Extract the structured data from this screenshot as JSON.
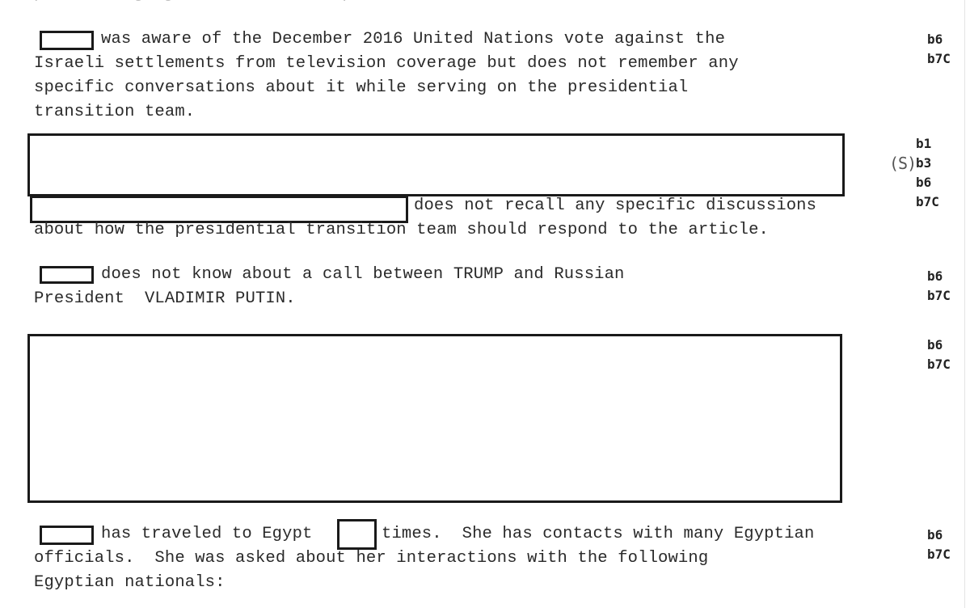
{
  "document": {
    "clipped_top_line": "preexisting agreements with respect to the other members",
    "paragraphs": [
      {
        "id": "un-vote",
        "lines": [
          "was aware of the December 2016 United Nations vote against the",
          "Israeli settlements from television coverage but does not remember any",
          "specific conversations about it while serving on the presidential",
          "transition team."
        ],
        "exemption_codes": [
          "b6",
          "b7C"
        ]
      },
      {
        "id": "article-response",
        "lines": [
          "does not recall any specific discussions",
          "about how the presidential transition team should respond to the article."
        ],
        "classification_mark": "(S)",
        "exemption_codes": [
          "b1",
          "b3",
          "b6",
          "b7C"
        ]
      },
      {
        "id": "putin-call",
        "lines": [
          "does not know about a call between TRUMP and Russian",
          "President  VLADIMIR PUTIN."
        ],
        "exemption_codes": [
          "b6",
          "b7C"
        ]
      },
      {
        "id": "fully-redacted",
        "lines": [],
        "exemption_codes": [
          "b6",
          "b7C"
        ]
      },
      {
        "id": "egypt-travel",
        "lines": [
          "has traveled to Egypt",
          "times.  She has contacts with many Egyptian",
          "officials.  She was asked about her interactions with the following",
          "Egyptian nationals:"
        ],
        "exemption_codes": [
          "b6",
          "b7C"
        ]
      }
    ]
  }
}
